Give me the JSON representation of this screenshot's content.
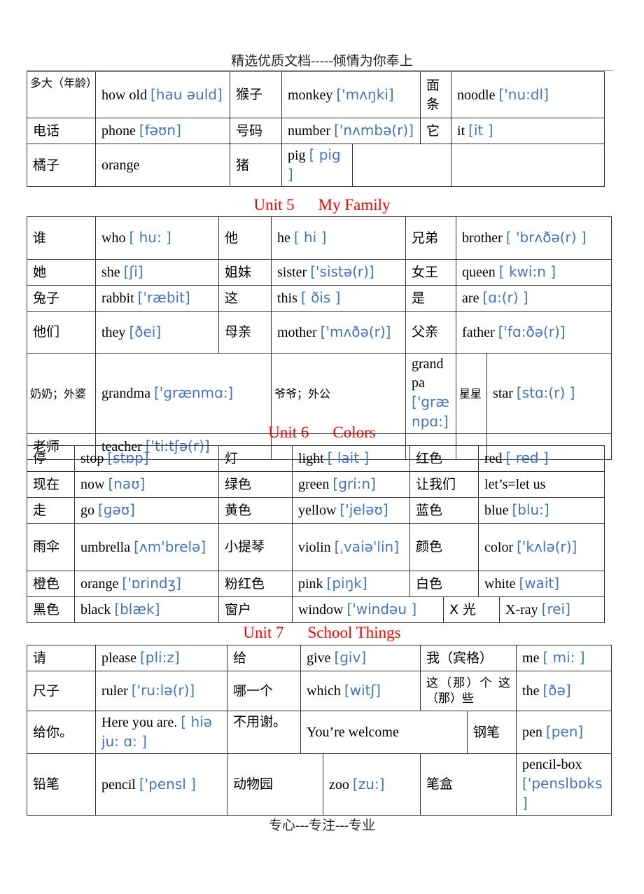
{
  "page": {
    "header": "精选优质文档-----倾情为你奉上",
    "footer": "专心---专注---专业"
  },
  "colors": {
    "unit_title": "#ff0000",
    "phonetic": "#4472c4",
    "text": "#000000"
  },
  "table0": {
    "rows": [
      [
        {
          "cn": "多大（年龄）"
        },
        {
          "en": "how old",
          "ph": "[hau əuld]"
        },
        {
          "cn": "猴子"
        },
        {
          "en": "monkey",
          "ph": "['mʌŋki]"
        },
        {
          "cn": "面条"
        },
        {
          "en": "noodle",
          "ph": "['nu:dl]"
        }
      ],
      [
        {
          "cn": "电话"
        },
        {
          "en": "phone",
          "ph": "[fəʊn]"
        },
        {
          "cn": "号码"
        },
        {
          "en": "number",
          "ph": "['nʌmbə(r)]"
        },
        {
          "cn": "它"
        },
        {
          "en": "it",
          "ph": "[it ]"
        }
      ],
      [
        {
          "cn": "橘子"
        },
        {
          "en": "orange",
          "ph": ""
        },
        {
          "cn": "猪"
        },
        {
          "en": "pig",
          "ph": "[ pig ]"
        },
        {
          "cn": ""
        },
        {
          "en": "",
          "ph": ""
        }
      ]
    ]
  },
  "unit5": {
    "title_unit": "Unit 5",
    "title_name": "My Family",
    "rows": [
      [
        {
          "cn": "谁"
        },
        {
          "en": "who",
          "ph": "[ hu: ]"
        },
        {
          "cn": "他"
        },
        {
          "en": "he",
          "ph": "[ hi ]"
        },
        {
          "cn": "兄弟"
        },
        {
          "en": "brother",
          "ph": "[ 'brʌðə(r) ]"
        }
      ],
      [
        {
          "cn": "她"
        },
        {
          "en": "she",
          "ph": "[ʃi]"
        },
        {
          "cn": "姐妹"
        },
        {
          "en": "sister",
          "ph": "['sistə(r)]"
        },
        {
          "cn": "女王"
        },
        {
          "en": "queen",
          "ph": "[ kwi:n ]"
        }
      ],
      [
        {
          "cn": "兔子"
        },
        {
          "en": "rabbit",
          "ph": "['ræbit]"
        },
        {
          "cn": "这"
        },
        {
          "en": "this",
          "ph": "[ ðis ]"
        },
        {
          "cn": "是"
        },
        {
          "en": "are",
          "ph": "[ɑ:(r) ]"
        }
      ],
      [
        {
          "cn": "他们"
        },
        {
          "en": "they",
          "ph": "[ðei]"
        },
        {
          "cn": "母亲"
        },
        {
          "en": "mother",
          "ph": "['mʌðə(r)]"
        },
        {
          "cn": "父亲"
        },
        {
          "en": "father",
          "ph": "['fɑ:ðə(r)]"
        }
      ],
      [
        {
          "cn": "奶奶；外婆"
        },
        {
          "en": "grandma",
          "ph": "['ɡrænmɑ:]"
        },
        {
          "cn": "爷爷；外公"
        },
        {
          "en": "grandpa",
          "ph": "['grænpɑ:]"
        },
        {
          "cn": "星星"
        },
        {
          "en": "star",
          "ph": "[stɑ:(r) ]"
        }
      ],
      [
        {
          "cn": "老师"
        },
        {
          "en": "teacher",
          "ph": "['ti:tʃə(r)]"
        },
        {
          "cn": ""
        },
        {
          "en": "",
          "ph": ""
        },
        {
          "cn": ""
        },
        {
          "en": "",
          "ph": ""
        }
      ]
    ]
  },
  "unit6": {
    "title_unit": "Unit 6",
    "title_name": "Colors",
    "rows": [
      [
        {
          "cn": "停"
        },
        {
          "en": "stop",
          "ph": "[stɒp]"
        },
        {
          "cn": "灯"
        },
        {
          "en": "light",
          "ph": "[ lait ]"
        },
        {
          "cn": "红色"
        },
        {
          "en": "red",
          "ph": "[ red ]"
        }
      ],
      [
        {
          "cn": "现在"
        },
        {
          "en": "now",
          "ph": "[naʊ]"
        },
        {
          "cn": "绿色"
        },
        {
          "en": "green",
          "ph": "[ɡri:n]"
        },
        {
          "cn": "让我们"
        },
        {
          "en": "let’s=let us",
          "ph": ""
        }
      ],
      [
        {
          "cn": "走"
        },
        {
          "en": "go",
          "ph": "[ɡəʊ]"
        },
        {
          "cn": "黄色"
        },
        {
          "en": "yellow",
          "ph": "['jeləʊ]"
        },
        {
          "cn": "蓝色"
        },
        {
          "en": "blue",
          "ph": "[blu:]"
        }
      ],
      [
        {
          "cn": "雨伞"
        },
        {
          "en": "umbrella",
          "ph": "[ʌm'brelə]"
        },
        {
          "cn": "小提琴"
        },
        {
          "en": "violin",
          "ph": "[ˌvaiə'lin]"
        },
        {
          "cn": "颜色"
        },
        {
          "en": "color",
          "ph": "['kʌlə(r)]"
        }
      ],
      [
        {
          "cn": "橙色"
        },
        {
          "en": "orange",
          "ph": "['ɒrindʒ]"
        },
        {
          "cn": "粉红色"
        },
        {
          "en": "pink",
          "ph": "[piŋk]"
        },
        {
          "cn": "白色"
        },
        {
          "en": "white",
          "ph": "[wait]"
        }
      ],
      [
        {
          "cn": "黑色"
        },
        {
          "en": "black",
          "ph": "[blæk]"
        },
        {
          "cn": "窗户"
        },
        {
          "en": "window",
          "ph": "['windəu ]"
        },
        {
          "cn": "X 光"
        },
        {
          "en": "X-ray",
          "ph": "[rei]"
        }
      ]
    ]
  },
  "unit7": {
    "title_unit": "Unit 7",
    "title_name": "School Things",
    "rows": [
      [
        {
          "cn": "请"
        },
        {
          "en": "please",
          "ph": "[pli:z]"
        },
        {
          "cn": "给"
        },
        {
          "en": "give",
          "ph": "[ɡiv]"
        },
        {
          "cn": "我（宾格）"
        },
        {
          "en": "me",
          "ph": "[ mi: ]"
        }
      ],
      [
        {
          "cn": "尺子"
        },
        {
          "en": "ruler",
          "ph": "['ru:lə(r)]"
        },
        {
          "cn": "哪一个"
        },
        {
          "en": "which",
          "ph": "[witʃ]"
        },
        {
          "cn": "这（那）个 这（那）些"
        },
        {
          "en": "the",
          "ph": "[ðə]"
        }
      ],
      [
        {
          "cn": "给你。"
        },
        {
          "en": "Here you are.",
          "ph": "[ hiə ju: ɑ: ]"
        },
        {
          "cn": "不用谢。"
        },
        {
          "en": "You’re welcome",
          "ph": ""
        },
        {
          "cn": "钢笔"
        },
        {
          "en": "pen",
          "ph": "[pen]"
        }
      ],
      [
        {
          "cn": "铅笔"
        },
        {
          "en": "pencil",
          "ph": "['pensl ]"
        },
        {
          "cn": "动物园"
        },
        {
          "en": "zoo",
          "ph": "[zu:]"
        },
        {
          "cn": "笔盒"
        },
        {
          "en": "pencil-box",
          "ph": "['penslbɒks ]"
        }
      ]
    ]
  }
}
